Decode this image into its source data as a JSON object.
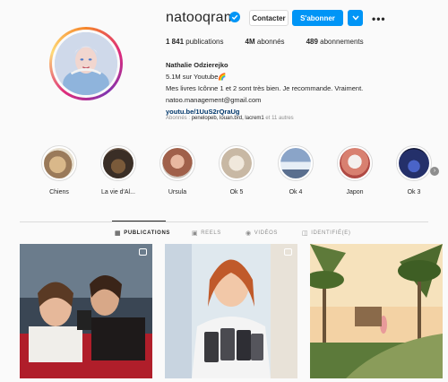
{
  "profile": {
    "username": "natooqram",
    "name": "Nathalie Odzierejko",
    "bio_lines": [
      "5.1M sur Youtube🌈",
      "Mes livres Icônne 1 et 2 sont très bien. Je recommande. Vraiment.",
      "natoo.management@gmail.com"
    ],
    "link": "youtu.be/1UuS2rQraUg",
    "followed_by_prefix": "Abonnés : ",
    "followed_by": "penelopeb, louan.brd, lacrem1",
    "followed_by_suffix": " et 11 autres"
  },
  "buttons": {
    "contact": "Contacter",
    "follow": "S'abonner",
    "more": "•••"
  },
  "stats": {
    "publications_count": "1 841",
    "publications_label": " publications",
    "followers_count": "4M",
    "followers_label": " abonnés",
    "following_count": "489",
    "following_label": " abonnements"
  },
  "highlights": [
    {
      "label": "Chiens",
      "color": "#c9a77a"
    },
    {
      "label": "La vie d'Al...",
      "color": "#5a4a3a"
    },
    {
      "label": "Ursula",
      "color": "#b07a6a"
    },
    {
      "label": "Ok 5",
      "color": "#d8c6b4"
    },
    {
      "label": "Ok 4",
      "color": "#5a6f8f"
    },
    {
      "label": "Japon",
      "color": "#c86a5a"
    },
    {
      "label": "Ok 3",
      "color": "#24306a"
    }
  ],
  "tabs": [
    {
      "label": "PUBLICATIONS",
      "icon": "grid-icon",
      "active": true
    },
    {
      "label": "REELS",
      "icon": "reels-icon",
      "active": false
    },
    {
      "label": "VIDÉOS",
      "icon": "video-icon",
      "active": false
    },
    {
      "label": "IDENTIFIÉ(E)",
      "icon": "tagged-icon",
      "active": false
    }
  ],
  "colors": {
    "accent": "#0095f6",
    "text": "#262626",
    "muted": "#8e8e8e",
    "link": "#00376b",
    "background": "#fafafa"
  }
}
